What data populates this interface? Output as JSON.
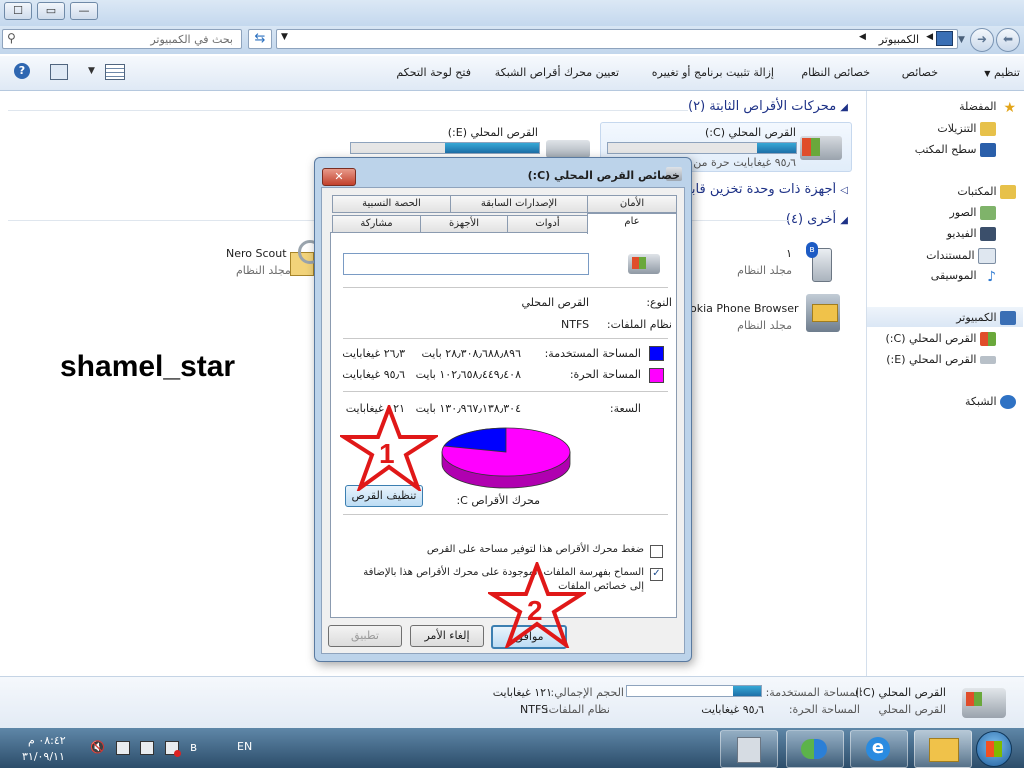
{
  "window": {
    "caption_buttons": [
      "☐",
      "▭",
      "—"
    ],
    "breadcrumb": "الكمبيوتر",
    "search_placeholder": "بحث في الكمبيوتر"
  },
  "toolbar": {
    "organize": "تنظيم",
    "properties": "خصائص",
    "system_properties": "خصائص النظام",
    "uninstall": "إزالة تثبيت برنامج أو تغييره",
    "map_drive": "تعيين محرك أقراص الشبكة",
    "control_panel": "فتح لوحة التحكم"
  },
  "nav": {
    "favorites": "المفضلة",
    "downloads": "التنزيلات",
    "desktop": "سطح المكتب",
    "libraries": "المكتبات",
    "pictures": "الصور",
    "videos": "الفيديو",
    "documents": "المستندات",
    "music": "الموسيقى",
    "computer": "الكمبيوتر",
    "local_c": "القرص المحلي (C:)",
    "local_e": "القرص المحلي (E:)",
    "network": "الشبكة"
  },
  "content": {
    "hard_drives_header": "محركات الأقراص الثابتة (٢)",
    "drive_c_label": "القرص المحلي (C:)",
    "drive_c_free": "٩٥٫٦ غيغابايت حرة من",
    "drive_e_label": "القرص المحلي (E:)",
    "removable_header": "أجهزة ذات وحدة تخزين قابلة لل",
    "other_header": "أخرى (٤)",
    "nero_name": "Nero Scout",
    "nero_sub": "مجلد النظام",
    "item1_name": "١",
    "item1_sub": "مجلد النظام",
    "nokia_name": "okia Phone Browser",
    "nokia_sub": "مجلد النظام"
  },
  "watermark": "shamel_star",
  "dialog": {
    "title": "خصائص القرص المحلي (C:)",
    "close": "✕",
    "tabs_row1": [
      "الأمان",
      "الإصدارات السابقة",
      "الحصة النسبية"
    ],
    "tabs_row2": [
      "عام",
      "أدوات",
      "الأجهزة",
      "مشاركة"
    ],
    "type_label": "النوع:",
    "type_value": "القرص المحلي",
    "fs_label": "نظام الملفات:",
    "fs_value": "NTFS",
    "used_label": "المساحة المستخدمة:",
    "used_bytes": "٢٨٫٣٠٨٫٦٨٨٫٨٩٦ بايت",
    "used_gb": "٢٦٫٣ غيغابايت",
    "free_label": "المساحة الحرة:",
    "free_bytes": "١٠٢٫٦٥٨٫٤٤٩٫٤٠٨ بايت",
    "free_gb": "٩٥٫٦ غيغابايت",
    "capacity_label": "السعة:",
    "capacity_bytes": "١٣٠٫٩٦٧٫١٣٨٫٣٠٤ بايت",
    "capacity_gb": "١٢١ غيغابايت",
    "drive_caption": "محرك الأقراص C:",
    "cleanup_button": "تنظيف القرص",
    "compress_check": "ضغط محرك الأقراص هذا لتوفير مساحة على القرص",
    "index_check_1": "السماح بفهرسة الملفات الموجودة على محرك الأقراص هذا بالإضافة",
    "index_check_2": "إلى خصائص الملفات",
    "ok": "موافق",
    "cancel": "إلغاء الأمر",
    "apply": "تطبيق",
    "star1": "1",
    "star2": "2",
    "used_color": "#0000ff",
    "free_color": "#ff00ff"
  },
  "details": {
    "drive_name": "القرص المحلي (C:)",
    "drive_type": "القرص المحلي",
    "used_label": "المساحة المستخدمة:",
    "total_label": "الحجم الإجمالي:",
    "total_value": "١٢١ غيغابايت",
    "free_label": "المساحة الحرة:",
    "free_value": "٩٥٫٦ غيغابايت",
    "fs_label": "نظام الملفات:",
    "fs_value": "NTFS",
    "used_fraction": 0.21
  },
  "taskbar": {
    "lang": "EN",
    "time": "٠٨:٤٢ م",
    "date": "٣١/٠٩/١١"
  }
}
